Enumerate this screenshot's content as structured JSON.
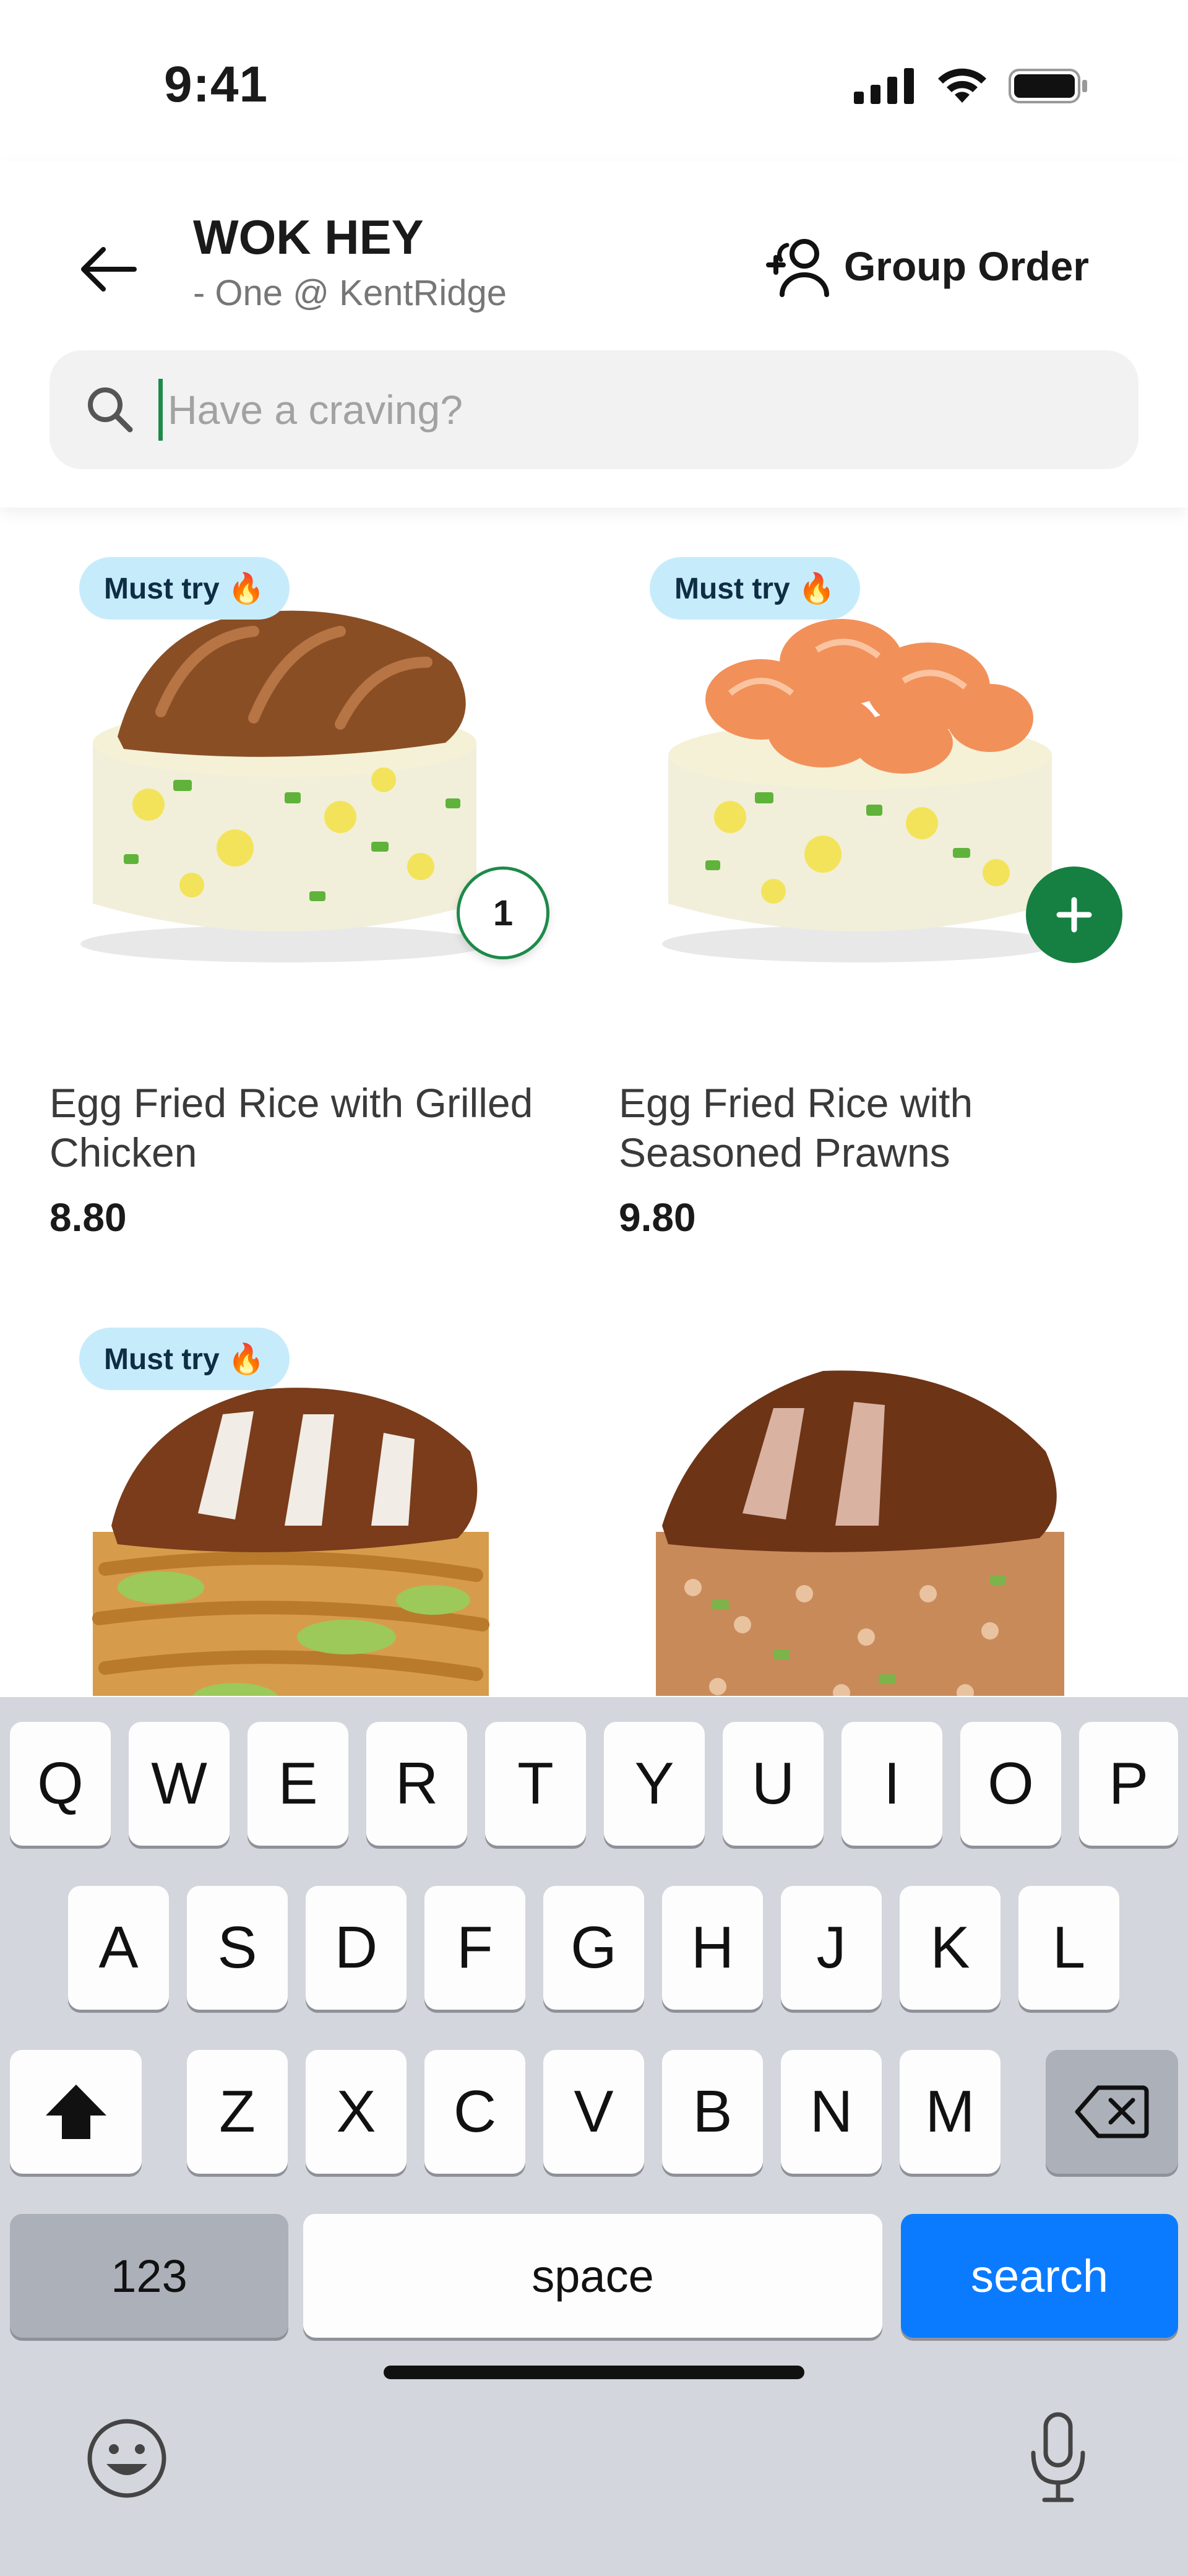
{
  "status_bar": {
    "time": "9:41"
  },
  "header": {
    "store_name": "WOK HEY",
    "store_branch": "- One @ KentRidge",
    "group_order_label": "Group Order",
    "search_placeholder": "Have a craving?",
    "search_value": ""
  },
  "menu": {
    "items": [
      {
        "badge": "Must try 🔥",
        "name": "Egg Fried Rice with Grilled Chicken",
        "price": "8.80",
        "quantity": "1"
      },
      {
        "badge": "Must try 🔥",
        "name": "Egg Fried Rice with Seasoned Prawns",
        "price": "9.80"
      },
      {
        "badge": "Must try 🔥"
      }
    ]
  },
  "keyboard": {
    "row1": [
      "Q",
      "W",
      "E",
      "R",
      "T",
      "Y",
      "U",
      "I",
      "O",
      "P"
    ],
    "row2": [
      "A",
      "S",
      "D",
      "F",
      "G",
      "H",
      "J",
      "K",
      "L"
    ],
    "row3": [
      "Z",
      "X",
      "C",
      "V",
      "B",
      "N",
      "M"
    ],
    "numbers_label": "123",
    "space_label": "space",
    "search_label": "search"
  },
  "colors": {
    "accent_green": "#158041",
    "badge_bg": "#c6ecfb",
    "search_key": "#0a7bff"
  }
}
